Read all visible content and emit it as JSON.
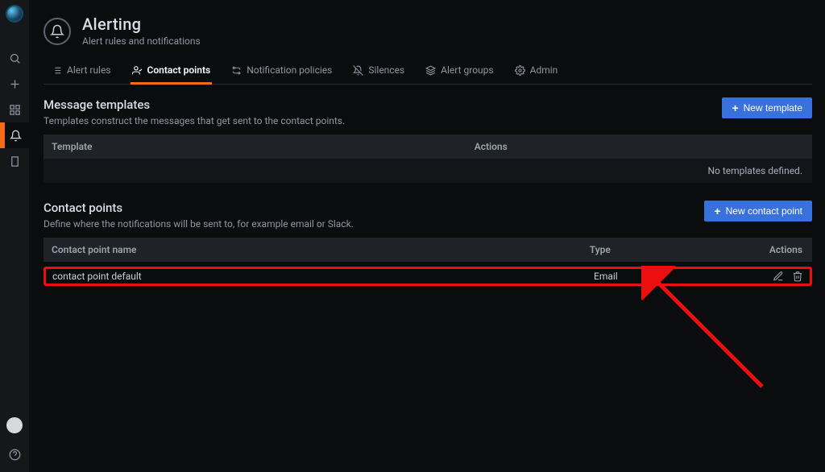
{
  "page": {
    "title": "Alerting",
    "subtitle": "Alert rules and notifications"
  },
  "tabs": [
    {
      "label": "Alert rules"
    },
    {
      "label": "Contact points"
    },
    {
      "label": "Notification policies"
    },
    {
      "label": "Silences"
    },
    {
      "label": "Alert groups"
    },
    {
      "label": "Admin"
    }
  ],
  "message_templates": {
    "title": "Message templates",
    "desc": "Templates construct the messages that get sent to the contact points.",
    "button": "New template",
    "columns": {
      "template": "Template",
      "actions": "Actions"
    },
    "empty": "No templates defined."
  },
  "contact_points": {
    "title": "Contact points",
    "desc": "Define where the notifications will be sent to, for example email or Slack.",
    "button": "New contact point",
    "columns": {
      "name": "Contact point name",
      "type": "Type",
      "actions": "Actions"
    },
    "rows": [
      {
        "name": "contact point default",
        "type": "Email"
      }
    ]
  },
  "colors": {
    "accent": "#f46b1a",
    "primary": "#3871dc",
    "annotation": "#ec0f0f"
  }
}
